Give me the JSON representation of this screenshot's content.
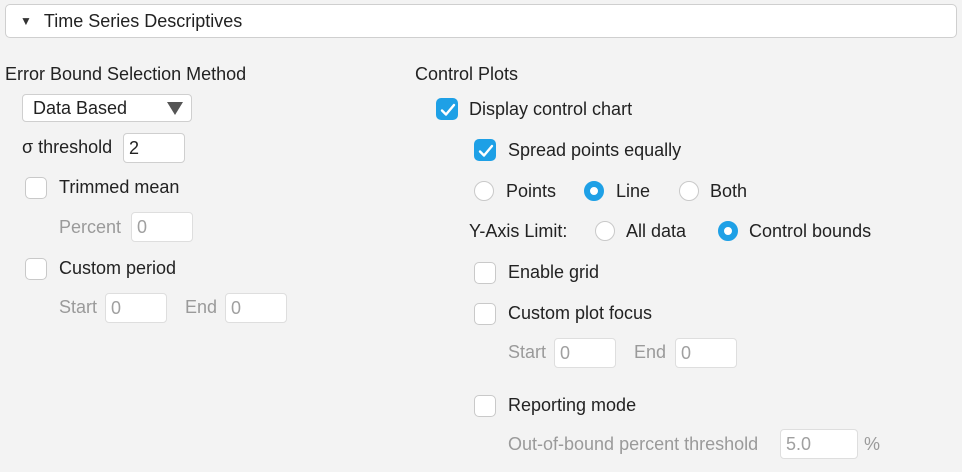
{
  "section": {
    "title": "Time Series Descriptives"
  },
  "left": {
    "heading": "Error Bound Selection Method",
    "method": {
      "selected": "Data Based"
    },
    "sigma": {
      "label": "σ threshold",
      "value": "2"
    },
    "trimmed": {
      "label": "Trimmed mean",
      "checked": false,
      "percent_label": "Percent",
      "percent_value": "0"
    },
    "custom_period": {
      "label": "Custom period",
      "checked": false,
      "start_label": "Start",
      "start_value": "0",
      "end_label": "End",
      "end_value": "0"
    }
  },
  "right": {
    "heading": "Control Plots",
    "display_control_chart": {
      "label": "Display control chart",
      "checked": true
    },
    "spread_points": {
      "label": "Spread points equally",
      "checked": true
    },
    "plot_type": {
      "options": [
        "Points",
        "Line",
        "Both"
      ],
      "selected": "Line"
    },
    "y_axis": {
      "label": "Y-Axis Limit:",
      "options": [
        "All data",
        "Control bounds"
      ],
      "selected": "Control bounds"
    },
    "enable_grid": {
      "label": "Enable grid",
      "checked": false
    },
    "custom_focus": {
      "label": "Custom plot focus",
      "checked": false,
      "start_label": "Start",
      "start_value": "0",
      "end_label": "End",
      "end_value": "0"
    },
    "reporting": {
      "label": "Reporting mode",
      "checked": false,
      "threshold_label": "Out-of-bound percent threshold",
      "threshold_value": "5.0",
      "unit": "%"
    }
  },
  "colors": {
    "accent": "#1ea0e6",
    "background": "#f3f3f3"
  }
}
